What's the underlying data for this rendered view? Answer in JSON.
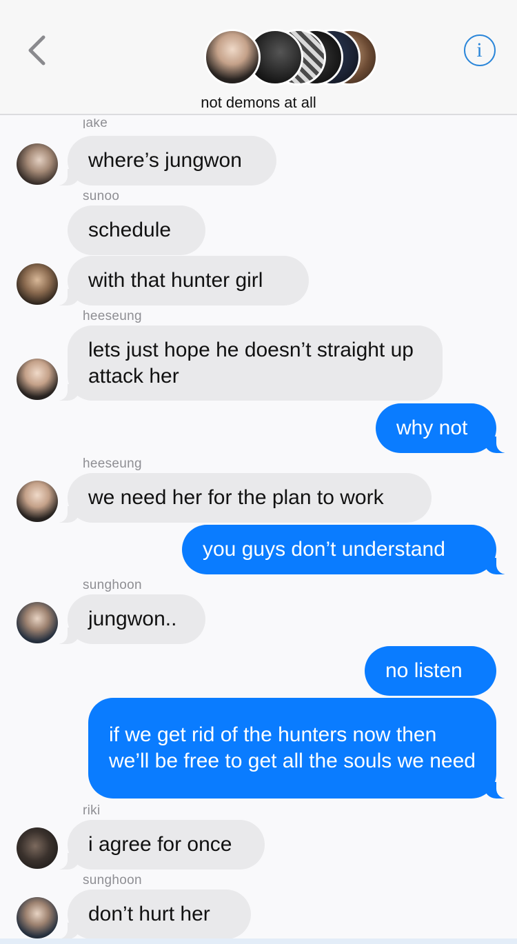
{
  "header": {
    "group_name": "not demons at all",
    "back_icon": "chevron-left-icon",
    "info_icon": "info-icon",
    "info_glyph": "i",
    "accent_color": "#2b86d9"
  },
  "colors": {
    "incoming_bubble": "#e9e9eb",
    "outgoing_bubble": "#0a7cff",
    "sender_label": "#8e8e93"
  },
  "messages": [
    {
      "sender": "jake",
      "text": "where’s jungwon"
    },
    {
      "sender": "sunoo",
      "text": "schedule"
    },
    {
      "sender": "",
      "text": "with that hunter girl"
    },
    {
      "sender": "heeseung",
      "text": "lets just hope he doesn’t straight up attack her"
    },
    {
      "sender": "",
      "text": "why not"
    },
    {
      "sender": "heeseung",
      "text": "we need her for the plan to work"
    },
    {
      "sender": "",
      "text": "you guys don’t understand"
    },
    {
      "sender": "sunghoon",
      "text": "jungwon.."
    },
    {
      "sender": "",
      "text": "no listen"
    },
    {
      "sender": "",
      "text": "if we get rid of the hunters now then we’ll be free to get all the souls we need"
    },
    {
      "sender": "riki",
      "text": "i agree for once"
    },
    {
      "sender": "sunghoon",
      "text": "don’t hurt her"
    }
  ]
}
